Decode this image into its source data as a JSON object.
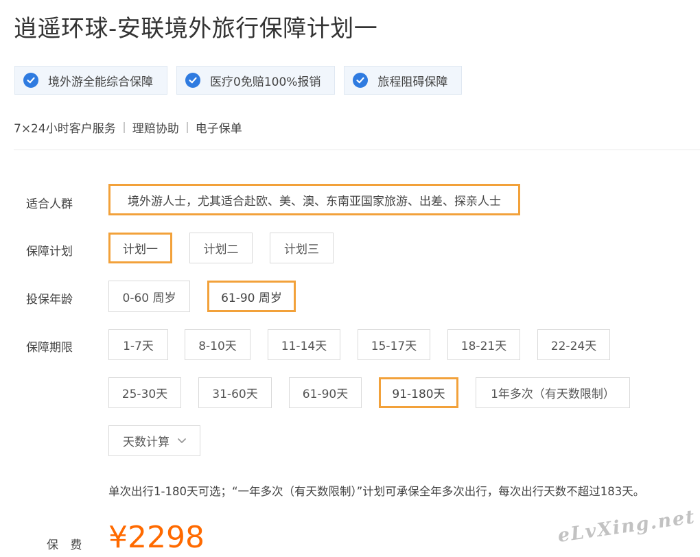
{
  "product": {
    "title": "逍遥环球-安联境外旅行保障计划一",
    "tags": [
      "境外游全能综合保障",
      "医疗0免赔100%报销",
      "旅程阻碍保障"
    ],
    "services": [
      "7×24小时客户服务",
      "理赔协助",
      "电子保单"
    ]
  },
  "options": {
    "audience": {
      "label": "适合人群",
      "value": "境外游人士，尤其适合赴欧、美、澳、东南亚国家旅游、出差、探亲人士"
    },
    "plan": {
      "label": "保障计划",
      "items": [
        "计划一",
        "计划二",
        "计划三"
      ],
      "selected": "计划一"
    },
    "age": {
      "label": "投保年龄",
      "items": [
        "0-60 周岁",
        "61-90 周岁"
      ],
      "selected": "61-90 周岁"
    },
    "period": {
      "label": "保障期限",
      "items": [
        "1-7天",
        "8-10天",
        "11-14天",
        "15-17天",
        "18-21天",
        "22-24天",
        "25-30天",
        "31-60天",
        "61-90天",
        "91-180天",
        "1年多次（有天数限制）"
      ],
      "selected": "91-180天",
      "calc_label": "天数计算"
    },
    "note": "单次出行1-180天可选；“一年多次（有天数限制）”计划可承保全年多次出行，每次出行天数不超过183天。"
  },
  "premium": {
    "label": "保 费",
    "price": "¥2298"
  },
  "watermark": "eLvXing.net",
  "colors": {
    "accent": "#f2a13a",
    "price": "#ff6a00",
    "check": "#2f7be0"
  },
  "icons": {
    "tag": "check-circle-icon",
    "dropdown": "chevron-down-icon"
  }
}
